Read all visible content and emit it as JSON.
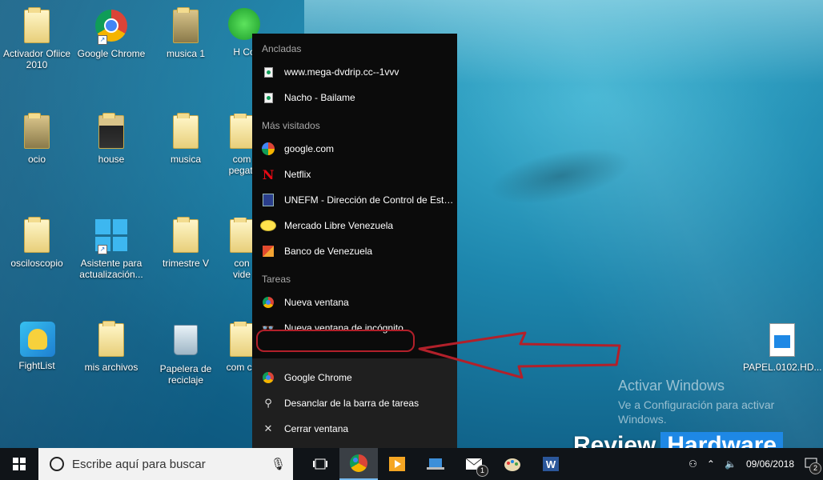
{
  "desktop": {
    "icons": [
      {
        "label": "Activador Ofiice 2010",
        "icon": "folder-icon"
      },
      {
        "label": "Google Chrome",
        "icon": "chrome-icon"
      },
      {
        "label": "musica 1",
        "icon": "folder-icon"
      },
      {
        "label": "H Co",
        "icon": "green-app-icon"
      },
      {
        "label": "ocio",
        "icon": "folder-icon"
      },
      {
        "label": "house",
        "icon": "folder-icon"
      },
      {
        "label": "musica",
        "icon": "folder-icon"
      },
      {
        "label": "com pegati",
        "icon": "folder-icon"
      },
      {
        "label": "osciloscopio",
        "icon": "folder-icon"
      },
      {
        "label": "Asistente para actualización...",
        "icon": "windows-logo-icon"
      },
      {
        "label": "trimestre V",
        "icon": "folder-icon"
      },
      {
        "label": "con vide",
        "icon": "folder-icon"
      },
      {
        "label": "FightList",
        "icon": "fightlist-icon"
      },
      {
        "label": "mis archivos",
        "icon": "folder-icon"
      },
      {
        "label": "Papelera de reciclaje",
        "icon": "recycle-bin-icon"
      },
      {
        "label": "com co",
        "icon": "folder-icon"
      },
      {
        "label": "PAPEL.0102.HD...",
        "icon": "video-file-icon"
      }
    ]
  },
  "jumplist": {
    "pinned_header": "Ancladas",
    "pinned": [
      {
        "label": "www.mega-dvdrip.cc--1vvv",
        "icon": "page-icon"
      },
      {
        "label": "Nacho - Bailame",
        "icon": "page-icon"
      }
    ],
    "frequent_header": "Más visitados",
    "frequent": [
      {
        "label": "google.com",
        "icon": "google-icon"
      },
      {
        "label": "Netflix",
        "icon": "netflix-icon"
      },
      {
        "label": "UNEFM - Dirección de Control de Estu...",
        "icon": "unefm-icon"
      },
      {
        "label": "Mercado Libre Venezuela",
        "icon": "mercadolibre-icon"
      },
      {
        "label": "Banco de Venezuela",
        "icon": "bank-icon"
      }
    ],
    "tasks_header": "Tareas",
    "tasks": [
      {
        "label": "Nueva ventana",
        "icon": "chrome-icon"
      },
      {
        "label": "Nueva ventana de incógnito",
        "icon": "incognito-icon"
      }
    ],
    "actions": [
      {
        "label": "Google Chrome",
        "icon": "chrome-icon"
      },
      {
        "label": "Desanclar de la barra de tareas",
        "icon": "unpin-icon"
      },
      {
        "label": "Cerrar ventana",
        "icon": "close-icon"
      }
    ]
  },
  "watermark": {
    "title": "Activar Windows",
    "subtitle": "Ve a Configuración para activar Windows."
  },
  "branding": {
    "review": "Review",
    "hardware": "Hardware"
  },
  "taskbar": {
    "search_placeholder": "Escribe aquí para buscar",
    "mail_badge": "1",
    "notification_badge": "2",
    "date": "09/06/2018"
  },
  "colors": {
    "highlight": "#b2202a",
    "taskbar": "#101418",
    "accent": "#76b9ed"
  }
}
